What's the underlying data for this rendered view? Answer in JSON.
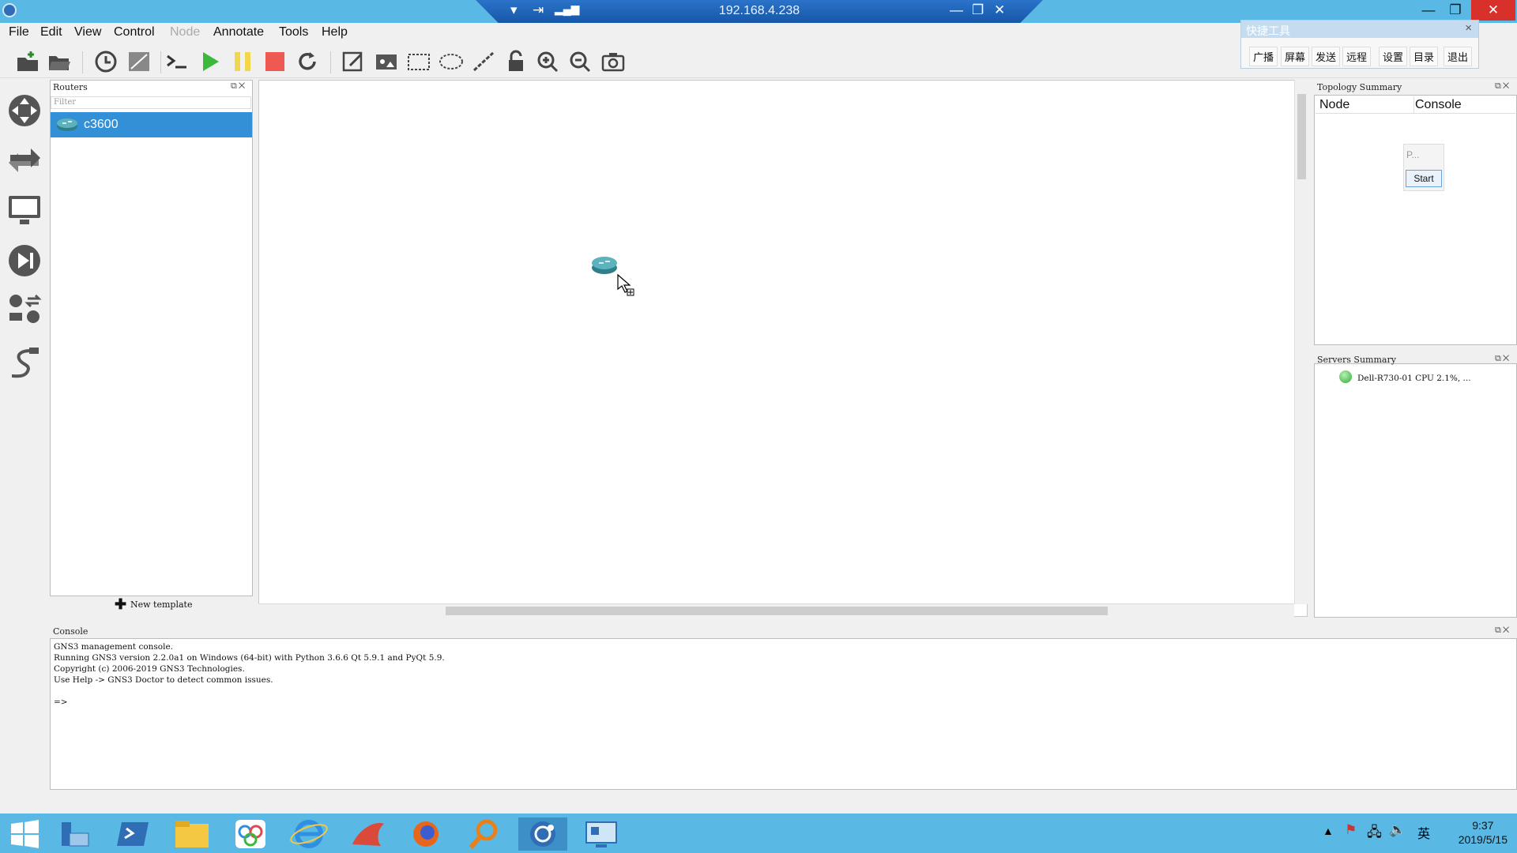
{
  "remote": {
    "ip": "192.168.4.238"
  },
  "menu": [
    "File",
    "Edit",
    "View",
    "Control",
    "Node",
    "Annotate",
    "Tools",
    "Help"
  ],
  "quick_tools": {
    "title": "快捷工具",
    "close": "×",
    "buttons": [
      "广播",
      "屏幕",
      "发送",
      "远程",
      "设置",
      "目录",
      "退出"
    ]
  },
  "routers_panel": {
    "title": "Routers",
    "filter_placeholder": "Filter",
    "items": [
      {
        "label": "c3600"
      }
    ],
    "new_template": "New template"
  },
  "topology": {
    "title": "Topology Summary",
    "col_node": "Node",
    "col_console": "Console",
    "popup_text": "P...",
    "popup_start": "Start"
  },
  "servers": {
    "title": "Servers Summary",
    "entry": "Dell-R730-01 CPU 2.1%, ..."
  },
  "console": {
    "title": "Console",
    "lines": [
      "GNS3 management console.",
      "Running GNS3 version 2.2.0a1 on Windows (64-bit) with Python 3.6.6 Qt 5.9.1 and PyQt 5.9.",
      "Copyright (c) 2006-2019 GNS3 Technologies.",
      "Use Help -> GNS3 Doctor to detect common issues.",
      "",
      "=>"
    ]
  },
  "taskbar": {
    "time": "9:37",
    "date": "2019/5/15",
    "ime": "英"
  },
  "colors": {
    "accent": "#3390d6",
    "titlebar": "#5ab9e4",
    "close": "#d8302b"
  }
}
